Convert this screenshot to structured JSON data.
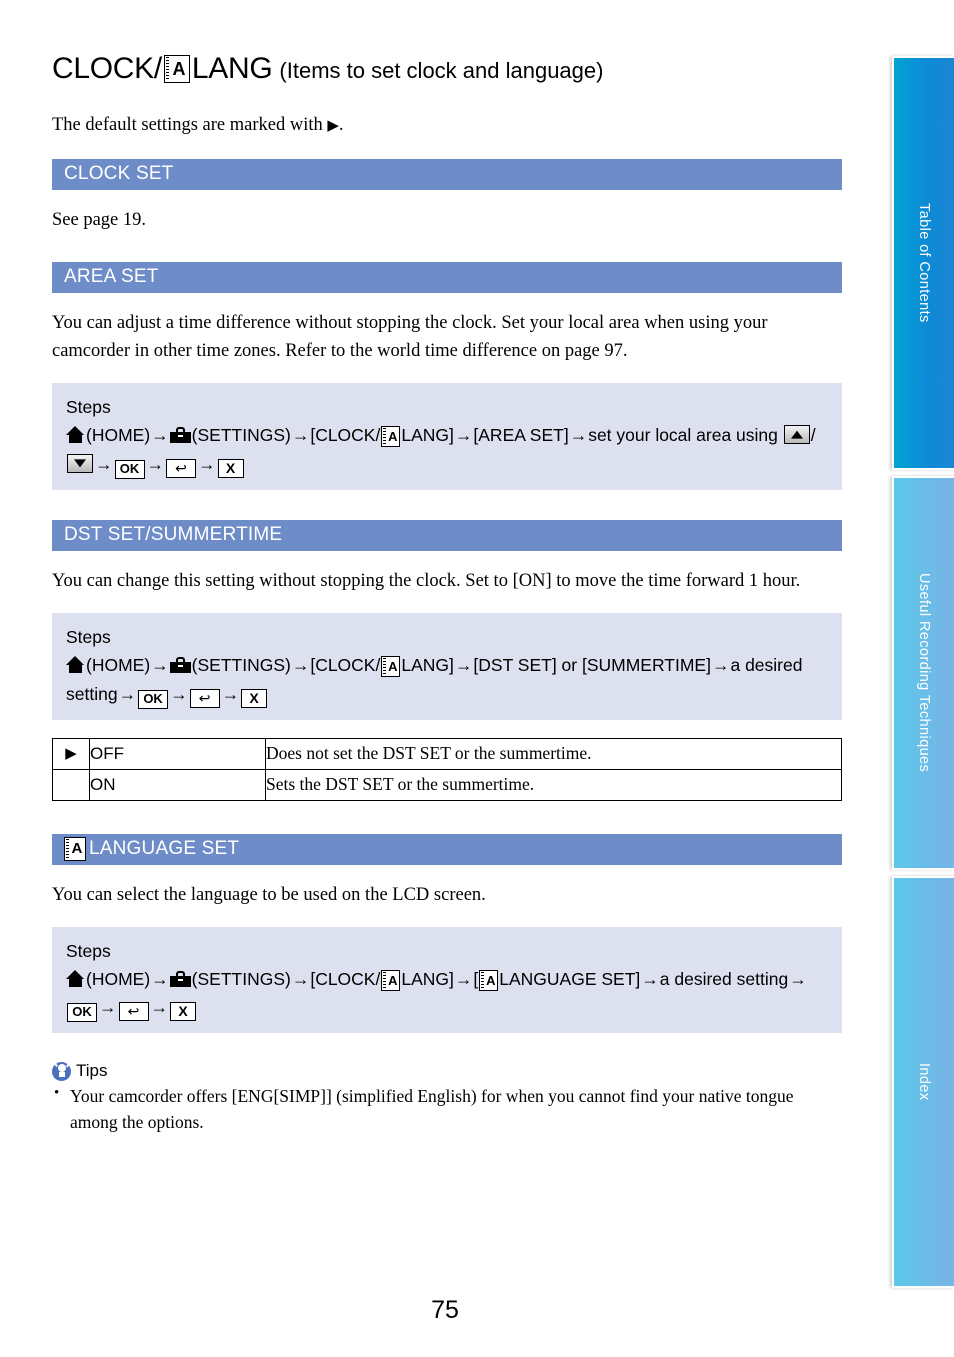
{
  "document": {
    "page_number": "75",
    "title_main_before": "CLOCK/",
    "title_icon": "a-language-icon",
    "title_main_after": "LANG",
    "title_sub": "(Items to set clock and language)",
    "intro_before": "The default settings are marked with ",
    "intro_marker": "▶",
    "intro_after": "."
  },
  "sections": [
    {
      "heading": "CLOCK SET",
      "body": "See page 19."
    },
    {
      "heading": "AREA SET",
      "body": "You can adjust a time difference without stopping the clock. Set your local area when using your camcorder in other time zones. Refer to the world time difference on page 97.",
      "steps": {
        "label": "Steps",
        "home_label": "(HOME)",
        "settings_label": "(SETTINGS)",
        "clock_open": "[CLOCK/",
        "clock_close": "LANG]",
        "target": "[AREA SET]",
        "action": "set your local area using",
        "ok_key": "OK",
        "return_key": "↩",
        "close_key": "X"
      }
    },
    {
      "heading": "DST SET/SUMMERTIME",
      "body": "You can change this setting without stopping the clock. Set to [ON] to move the time forward 1 hour.",
      "steps": {
        "label": "Steps",
        "home_label": "(HOME)",
        "settings_label": "(SETTINGS)",
        "clock_open": "[CLOCK/",
        "clock_close": "LANG]",
        "target": "[DST SET] or [SUMMERTIME]",
        "action": "a desired setting",
        "ok_key": "OK",
        "return_key": "↩",
        "close_key": "X"
      },
      "options": [
        {
          "marker": "▶",
          "name": "OFF",
          "description": "Does not set the DST SET or the summertime."
        },
        {
          "marker": "",
          "name": "ON",
          "description": "Sets the DST SET or the summertime."
        }
      ]
    },
    {
      "heading_icon": "a-language-icon",
      "heading": "LANGUAGE SET",
      "body": "You can select the language to be used on the LCD screen.",
      "steps": {
        "label": "Steps",
        "home_label": "(HOME)",
        "settings_label": "(SETTINGS)",
        "clock_open": "[CLOCK/",
        "clock_close": "LANG]",
        "target_open": "[",
        "target_close": "LANGUAGE SET]",
        "action": "a desired setting",
        "ok_key": "OK",
        "return_key": "↩",
        "close_key": "X"
      }
    }
  ],
  "tips": {
    "icon": "lightbulb-icon",
    "heading": "Tips",
    "items": [
      "Your camcorder offers [ENG[SIMP]] (simplified English) for when you cannot find your native tongue among the options."
    ]
  },
  "side_tabs": [
    {
      "label": "Table of Contents",
      "color": "#0D8AD6"
    },
    {
      "label": "Useful Recording Techniques",
      "color": "#6BBCE8"
    },
    {
      "label": "Index",
      "color": "#6BBCE8"
    }
  ],
  "colors": {
    "section_header_bg": "#6E8CC8",
    "steps_bg": "#DDE1EF",
    "tab_active": "#0D8AD6",
    "tab_inactive": "#6BBCE8",
    "tips_icon": "#4A6FBF"
  },
  "arrow": "→",
  "slash": "/"
}
